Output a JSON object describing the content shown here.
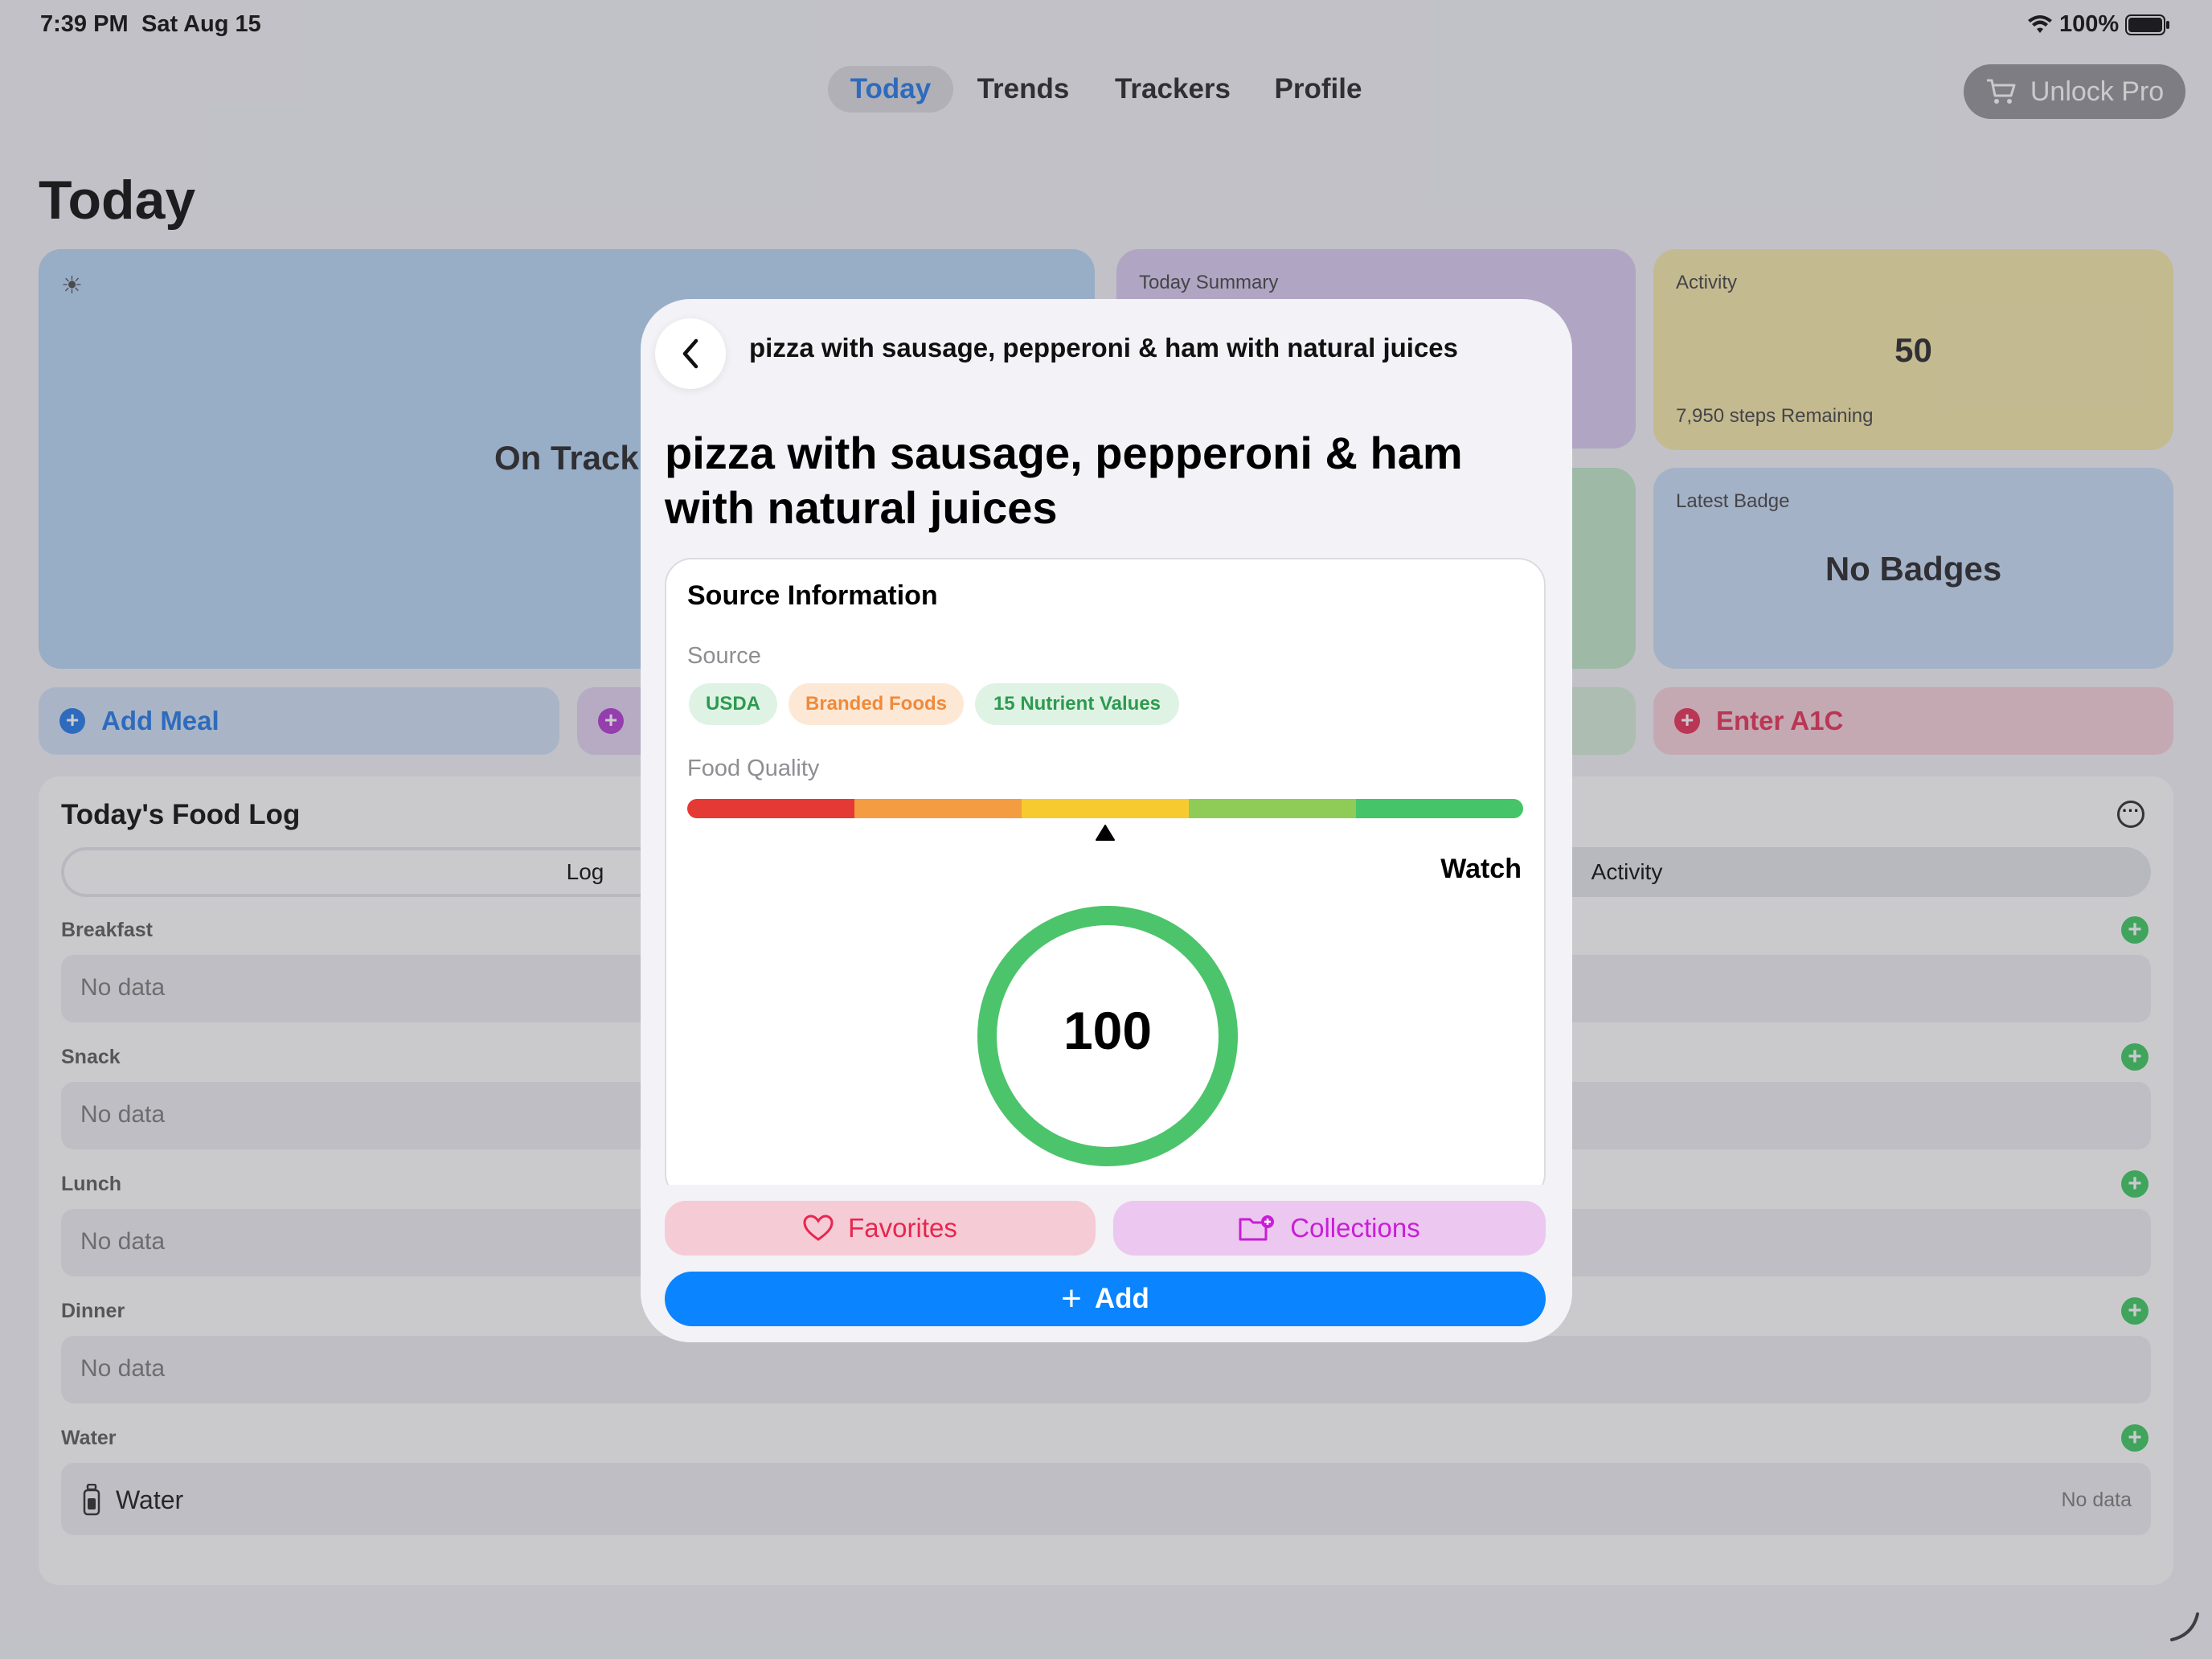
{
  "status_bar": {
    "time": "7:39 PM",
    "date": "Sat Aug 15",
    "battery": "100%"
  },
  "nav": {
    "tabs": [
      {
        "label": "Today"
      },
      {
        "label": "Trends"
      },
      {
        "label": "Trackers"
      },
      {
        "label": "Profile"
      }
    ],
    "active_tab": "Today",
    "unlock_label": "Unlock Pro"
  },
  "page": {
    "title": "Today"
  },
  "cards": {
    "status": {
      "text": "On Track"
    },
    "summary": {
      "label": "Today Summary"
    },
    "activity": {
      "label": "Activity",
      "value": "50",
      "sub": "7,950 steps Remaining"
    },
    "badge": {
      "label": "Latest Badge",
      "value": "No Badges"
    }
  },
  "actions": {
    "add_meal": "Add Meal",
    "enter_a1c": "Enter A1C"
  },
  "food_log": {
    "title": "Today's Food Log",
    "segments": [
      {
        "label": "Log"
      },
      {
        "label": "Activity"
      }
    ],
    "meals": [
      {
        "label": "Breakfast",
        "value": "No data"
      },
      {
        "label": "Snack",
        "value": "No data"
      },
      {
        "label": "Lunch",
        "value": "No data"
      },
      {
        "label": "Dinner",
        "value": "No data"
      }
    ],
    "water": {
      "label": "Water",
      "row_label": "Water",
      "value": "No data"
    }
  },
  "modal": {
    "header_title": "pizza with sausage, pepperoni & ham with natural juices",
    "title": "pizza with sausage, pepperoni & ham with natural juices",
    "source_info_title": "Source Information",
    "source_label": "Source",
    "chips": [
      {
        "label": "USDA"
      },
      {
        "label": "Branded Foods"
      },
      {
        "label": "15 Nutrient Values"
      }
    ],
    "food_quality_label": "Food Quality",
    "quality_level": 0.5,
    "quality_rating": "Watch",
    "score": "100",
    "score_fraction": 1.0,
    "favorites_label": "Favorites",
    "collections_label": "Collections",
    "add_label": "Add"
  },
  "colors": {
    "accent_blue": "#0a84ff",
    "favorites_red": "#e8264f",
    "collections_purple": "#c81ed6",
    "ring_green": "#4cc46b",
    "quality_segments": [
      "#e53935",
      "#f39c42",
      "#f7cb2f",
      "#8fcc57",
      "#45c46a"
    ]
  }
}
